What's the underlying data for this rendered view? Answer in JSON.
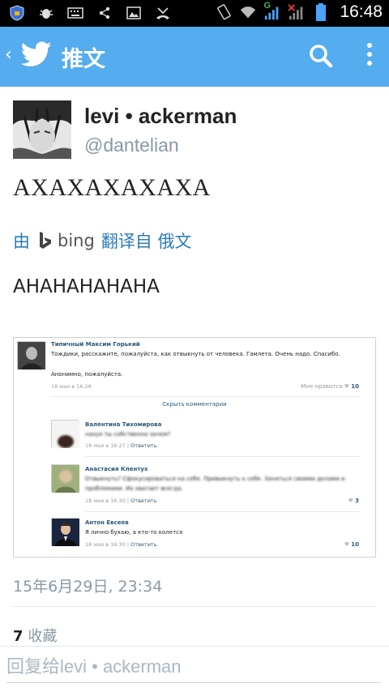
{
  "status_bar": {
    "time": "16:48",
    "network_label": "G",
    "icons": [
      "shield-icon",
      "bug-icon",
      "keyboard-icon",
      "share-icon",
      "image-icon",
      "missed-call-icon",
      "vibrate-icon",
      "wifi-icon",
      "signal-icon",
      "signal-no-service-icon",
      "battery-icon"
    ]
  },
  "app_bar": {
    "title": "推文",
    "icons": [
      "back-icon",
      "twitter-bird-icon",
      "search-icon",
      "more-vertical-icon"
    ],
    "accent_color": "#55acee"
  },
  "tweet": {
    "user_name": "levi • ackerman",
    "handle": "@dantelian",
    "text": "ΑΧΑΧΑΧΑΧΑΧΑ",
    "translate": {
      "prefix": "由",
      "provider": "bing",
      "suffix": "翻译自 俄文"
    },
    "translated_text": "AHAHAHAHAHA",
    "timestamp": "15年6月29日, 23:34",
    "favorites_count": "7",
    "favorites_label": "收藏"
  },
  "media": {
    "post": {
      "author": "Типичный Максим Горький",
      "text": "Тождики, расскажите, пожалуйста, как отвыкнуть от человека. Гамлета. Очень надо. Спасибо.",
      "text2": "Анонимно, пожалуйста.",
      "date": "18 мая в 16:26",
      "like_label": "Мне нравится",
      "like_count": "10",
      "hide_comments": "Скрыть комментарии"
    },
    "comments": [
      {
        "author": "Валентина Тихомирова",
        "text": "нахуя ты собственно зачем?",
        "date": "18 мая в 16:27",
        "reply": "Ответить",
        "likes": ""
      },
      {
        "author": "Анастасия Клентух",
        "text": "Отвыкнуть? Сфокусироваться на себе. Привыкнуть к себе. Заняться своими делами и",
        "text2": "проблемами. Их хватает всегда.",
        "date": "18 мая в 16:30",
        "reply": "Ответить",
        "likes": "3"
      },
      {
        "author": "Антон Евсеев",
        "text": "Я лично бухаю, а кто-то колется",
        "date": "18 мая в 16:30",
        "reply": "Ответить",
        "likes": "10"
      }
    ]
  },
  "reply": {
    "placeholder": "回复给levi • ackerman"
  }
}
